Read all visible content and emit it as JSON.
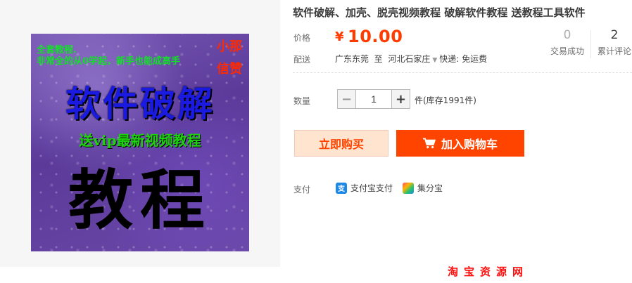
{
  "product": {
    "title": "软件破解、加壳、脱壳视频教程 破解软件教程 送教程工具软件",
    "image": {
      "line1": "全套教程.",
      "line2": "非常全的从0学起，新手也能成高手",
      "corner1": "小那",
      "corner2": "信赞",
      "headline": "软件破解",
      "subline": "送vip最新视频教程",
      "big_text": "教程"
    }
  },
  "price": {
    "label": "价格",
    "currency": "¥",
    "value": "10.00",
    "color": "#ff3c00"
  },
  "stats": {
    "sales_count": "0",
    "sales_label": "交易成功",
    "review_count": "2",
    "review_label": "累计评论"
  },
  "shipping": {
    "label": "配送",
    "from": "广东东莞",
    "to_word": "至",
    "to": "河北石家庄",
    "chevron_icon": "chevron-down-icon",
    "method": "快递: 免运费"
  },
  "quantity": {
    "label": "数量",
    "minus": "−",
    "value": "1",
    "plus": "+",
    "stock_text": "件(库存1991件)"
  },
  "actions": {
    "buy_now": "立即购买",
    "add_to_cart": "加入购物车",
    "accent": "#ff4400"
  },
  "payment": {
    "label": "支付",
    "methods": [
      {
        "icon": "alipay-icon",
        "glyph": "支",
        "label": "支付宝支付"
      },
      {
        "icon": "jifenbao-icon",
        "glyph": "",
        "label": "集分宝"
      }
    ]
  },
  "watermark": "淘宝资源网"
}
